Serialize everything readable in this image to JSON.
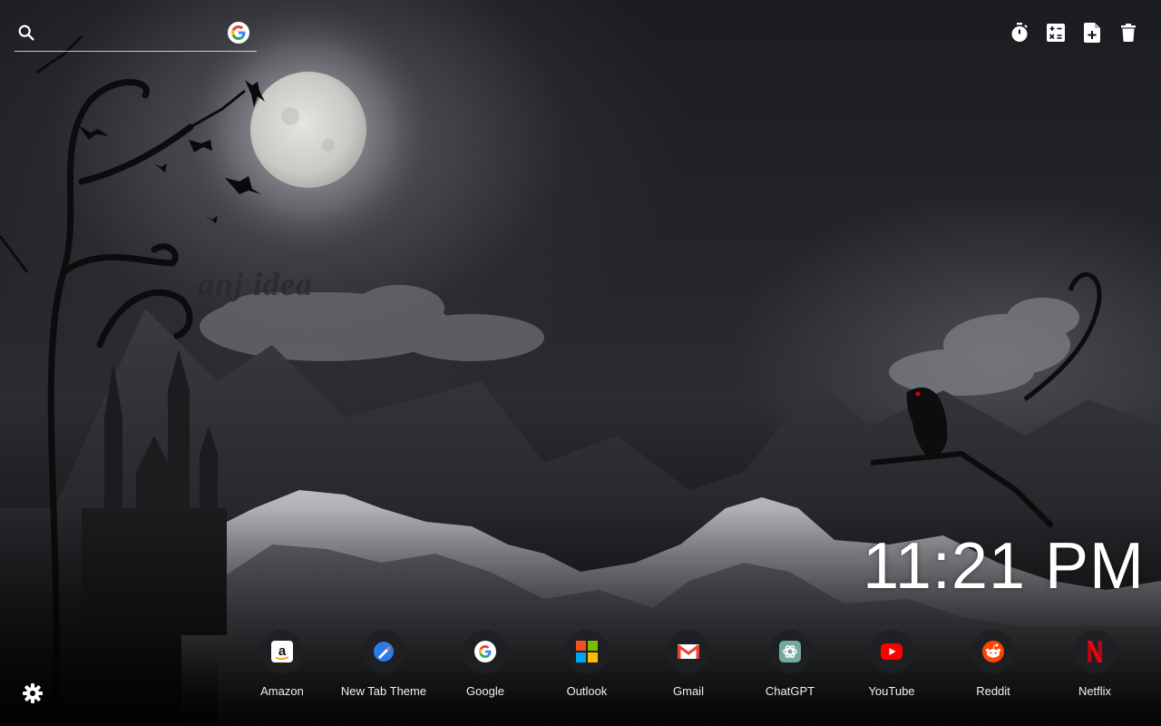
{
  "search": {
    "placeholder": "",
    "engine_icon": "google-g-icon"
  },
  "toolbar": {
    "items": [
      {
        "name": "timer-button",
        "icon": "stopwatch-icon"
      },
      {
        "name": "calculator-button",
        "icon": "calculator-icon"
      },
      {
        "name": "new-note-button",
        "icon": "note-add-icon"
      },
      {
        "name": "delete-button",
        "icon": "trash-icon"
      }
    ]
  },
  "clock": {
    "time": "11:21 PM"
  },
  "watermark": "anj idea",
  "shortcuts": [
    {
      "label": "Amazon",
      "icon": "amazon-icon"
    },
    {
      "label": "New Tab Theme",
      "icon": "new-tab-theme-icon"
    },
    {
      "label": "Google",
      "icon": "google-icon"
    },
    {
      "label": "Outlook",
      "icon": "outlook-icon"
    },
    {
      "label": "Gmail",
      "icon": "gmail-icon"
    },
    {
      "label": "ChatGPT",
      "icon": "chatgpt-icon"
    },
    {
      "label": "YouTube",
      "icon": "youtube-icon"
    },
    {
      "label": "Reddit",
      "icon": "reddit-icon"
    },
    {
      "label": "Netflix",
      "icon": "netflix-icon"
    }
  ],
  "settings": {
    "icon": "gear-icon"
  },
  "colors": {
    "google_blue": "#4285F4",
    "google_red": "#EA4335",
    "google_yellow": "#FBBC05",
    "google_green": "#34A853",
    "youtube_red": "#FF0000",
    "reddit_orange": "#FF4500",
    "netflix_red": "#E50914",
    "chatgpt_green": "#74AA9C"
  }
}
